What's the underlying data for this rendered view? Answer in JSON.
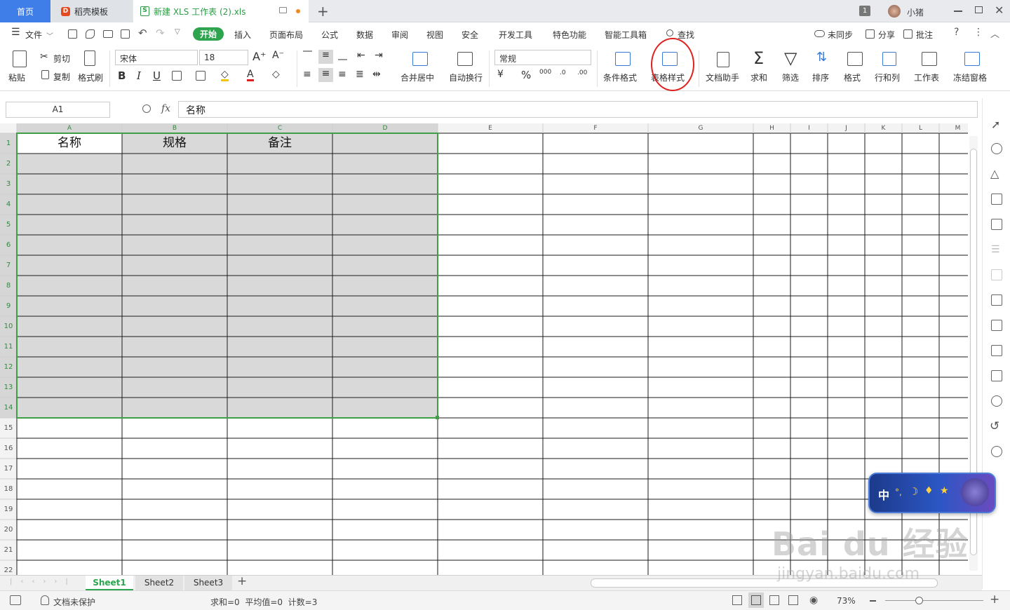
{
  "tabs": {
    "home": "首页",
    "template": "稻壳模板",
    "doc": "新建 XLS 工作表 (2).xls",
    "add": "+"
  },
  "titlebar": {
    "badge": "1",
    "user": "小猪"
  },
  "menu": {
    "file": "文件",
    "items": [
      "开始",
      "插入",
      "页面布局",
      "公式",
      "数据",
      "审阅",
      "视图",
      "安全",
      "开发工具",
      "特色功能",
      "智能工具箱"
    ],
    "search": "查找",
    "sync": "未同步",
    "share": "分享",
    "comment": "批注"
  },
  "ribbon": {
    "paste": "粘贴",
    "cut": "剪切",
    "copy": "复制",
    "format_painter": "格式刷",
    "font": "宋体",
    "size": "18",
    "number_format": "常规",
    "merge": "合并居中",
    "wrap": "自动换行",
    "cond_format": "条件格式",
    "table_style": "表格样式",
    "doc_helper": "文档助手",
    "sum": "求和",
    "filter": "筛选",
    "sort": "排序",
    "format": "格式",
    "rowcol": "行和列",
    "sheet": "工作表",
    "freeze": "冻结窗格"
  },
  "formula": {
    "cell_ref": "A1",
    "fx": "fx",
    "content": "名称"
  },
  "grid": {
    "cols": [
      "A",
      "B",
      "C",
      "D",
      "E",
      "F",
      "G",
      "H",
      "I",
      "J",
      "K",
      "L",
      "M"
    ],
    "rows": [
      "1",
      "2",
      "3",
      "4",
      "5",
      "6",
      "7",
      "8",
      "9",
      "10",
      "11",
      "12",
      "13",
      "14",
      "15",
      "16",
      "17",
      "18",
      "19",
      "20",
      "21",
      "22"
    ],
    "header_cells": [
      "名称",
      "规格",
      "备注"
    ]
  },
  "sheets": [
    "Sheet1",
    "Sheet2",
    "Sheet3"
  ],
  "status": {
    "protect": "文档未保护",
    "summary": "求和=0  平均值=0  计数=3",
    "zoom": "73%"
  },
  "ime": {
    "label": "中"
  },
  "watermark": {
    "main": "Bai du 经验",
    "url": "jingyan.baidu.com"
  },
  "colors": {
    "accent": "#2ea44f",
    "selection": "#3f9f46",
    "sel_fill": "#d9d9d9",
    "highlight_circle": "#e02020"
  }
}
